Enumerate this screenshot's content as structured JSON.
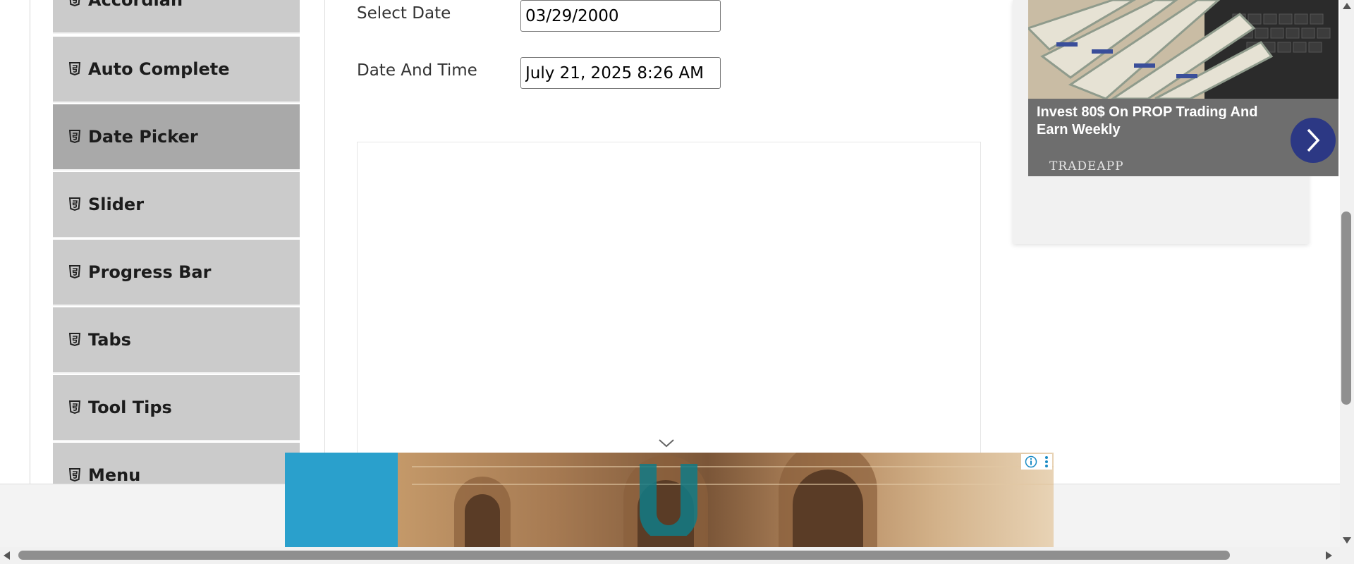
{
  "sidebar": {
    "items": [
      {
        "label": "Accordian",
        "icon": "html5-icon",
        "active": false
      },
      {
        "label": "Auto Complete",
        "icon": "html5-icon",
        "active": false
      },
      {
        "label": "Date Picker",
        "icon": "html5-icon",
        "active": true
      },
      {
        "label": "Slider",
        "icon": "html5-icon",
        "active": false
      },
      {
        "label": "Progress Bar",
        "icon": "html5-icon",
        "active": false
      },
      {
        "label": "Tabs",
        "icon": "html5-icon",
        "active": false
      },
      {
        "label": "Tool Tips",
        "icon": "html5-icon",
        "active": false
      },
      {
        "label": "Menu",
        "icon": "html5-icon",
        "active": false
      }
    ]
  },
  "form": {
    "select_date_label": "Select Date",
    "select_date_value": "03/29/2000",
    "date_time_label": "Date And Time",
    "date_time_value": "July 21, 2025 8:26 AM"
  },
  "ad_right": {
    "title": "Invest 80$ On PROP Trading And Earn Weekly",
    "brand": "TRADEAPP",
    "arrow_icon": "chevron-right-icon",
    "accent_color": "#2c3884"
  },
  "ad_bottom": {
    "choice_icons": [
      "info-icon",
      "more-vertical-icon"
    ],
    "collapse_icon": "chevron-down-icon"
  },
  "colors": {
    "sidebar_item": "#cbcbcb",
    "sidebar_active": "#a9a9a9"
  }
}
